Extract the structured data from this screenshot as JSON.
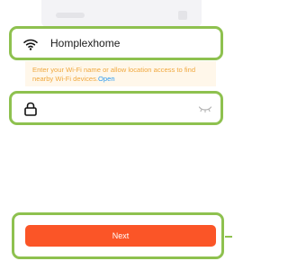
{
  "wifi": {
    "ssid": "Homplexhome",
    "icon": "wifi-icon"
  },
  "notice": {
    "text": "Enter your Wi-Fi name or allow location access to find nearby Wi-Fi devices.",
    "link": "Open"
  },
  "password": {
    "value": "",
    "placeholder": "",
    "icon": "lock-icon",
    "toggle_icon": "eye-closed-icon"
  },
  "actions": {
    "next_label": "Next"
  },
  "colors": {
    "accent": "#fb5527",
    "highlight_border": "#8ec14f",
    "notice_bg": "#fff7ea",
    "notice_text": "#f0a83e",
    "link": "#2d9bf0"
  }
}
